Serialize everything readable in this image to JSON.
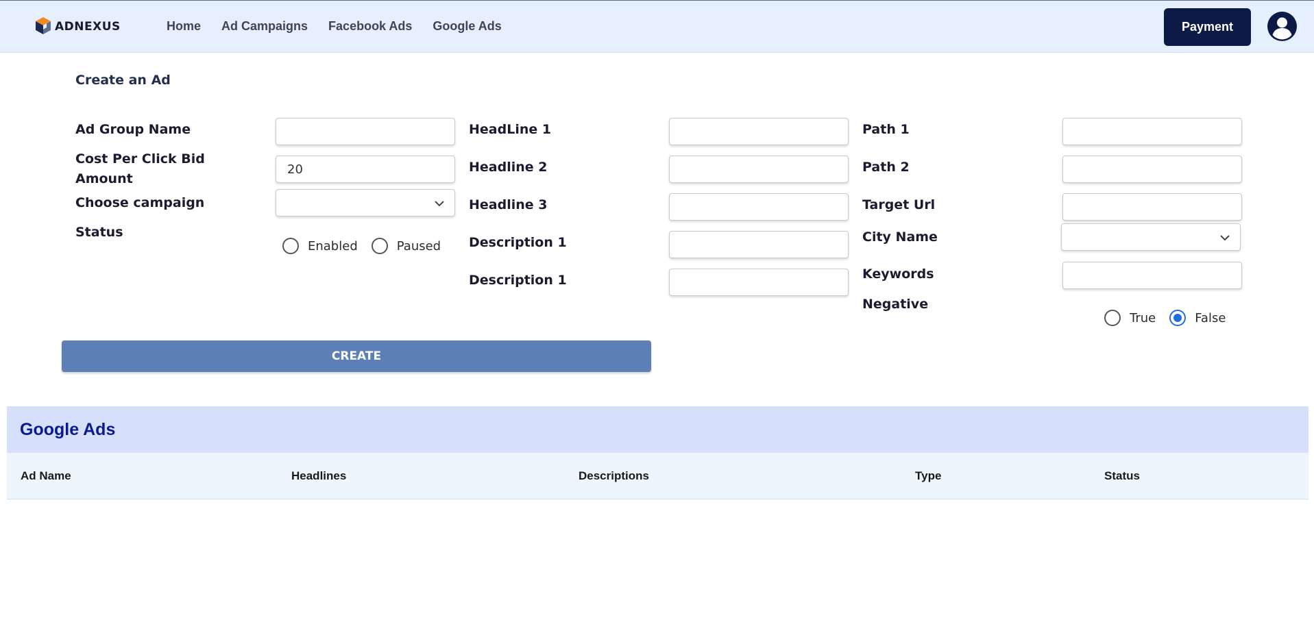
{
  "header": {
    "logo_text": "ADNEXUS",
    "nav": [
      "Home",
      "Ad Campaigns",
      "Facebook Ads",
      "Google Ads"
    ],
    "payment_label": "Payment",
    "brand_color": "#0c1b46"
  },
  "form": {
    "title": "Create an Ad",
    "ad_group_name": {
      "label": "Ad Group Name",
      "value": ""
    },
    "cpc": {
      "label_line1": "Cost Per Click Bid",
      "label_line2": "Amount",
      "value": "20"
    },
    "campaign": {
      "label": "Choose campaign",
      "value": ""
    },
    "status": {
      "label": "Status",
      "options": [
        "Enabled",
        "Paused"
      ],
      "selected": ""
    },
    "headline1": {
      "label": "HeadLine 1",
      "value": ""
    },
    "headline2": {
      "label": "Headline 2",
      "value": ""
    },
    "headline3": {
      "label": "Headline 3",
      "value": ""
    },
    "description1": {
      "label": "Description 1",
      "value": ""
    },
    "description2": {
      "label": "Description 1",
      "value": ""
    },
    "path1": {
      "label": "Path 1",
      "value": ""
    },
    "path2": {
      "label": "Path 2",
      "value": ""
    },
    "target_url": {
      "label": "Target Url",
      "value": ""
    },
    "city_name": {
      "label": "City Name",
      "value": ""
    },
    "keywords": {
      "label": "Keywords",
      "value": ""
    },
    "negative": {
      "label": "Negative",
      "options": [
        "True",
        "False"
      ],
      "selected": "False"
    },
    "create_label": "CREATE"
  },
  "table": {
    "title": "Google Ads",
    "columns": [
      "Ad Name",
      "Headlines",
      "Descriptions",
      "Type",
      "Status"
    ],
    "rows": []
  }
}
